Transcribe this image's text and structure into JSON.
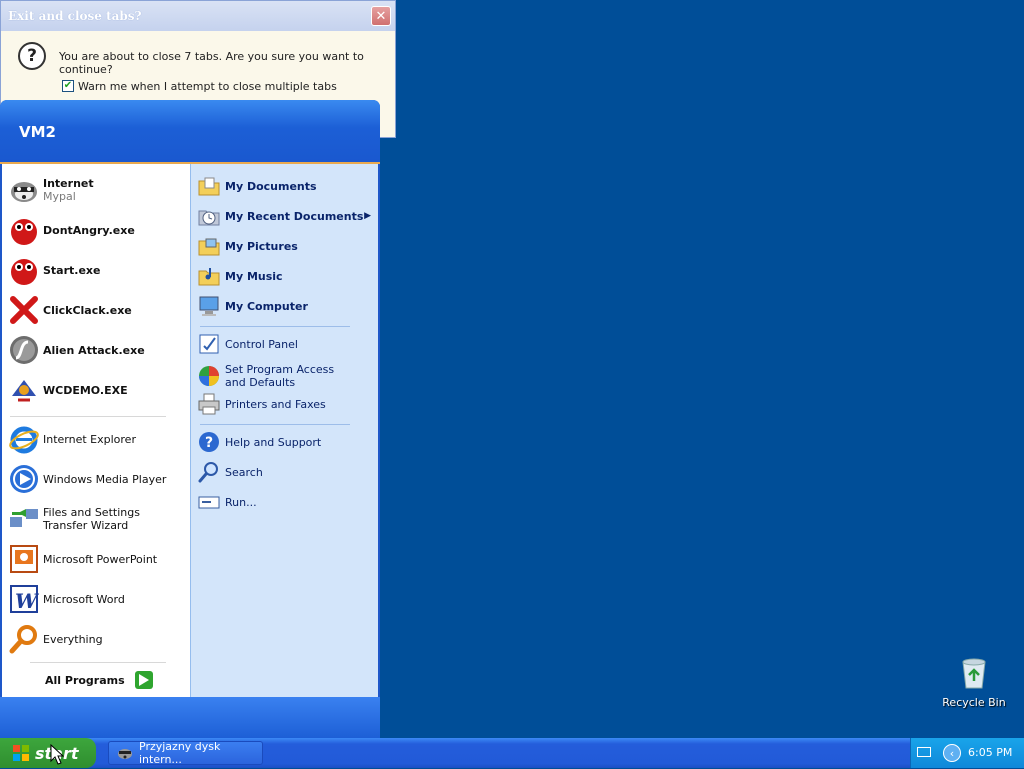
{
  "dialog": {
    "title": "Exit and close tabs?",
    "close_glyph": "✕",
    "question_glyph": "?",
    "message": "You are about to close 7 tabs. Are you sure you want to continue?",
    "checkbox_label": "Warn me when I attempt to close multiple tabs",
    "checkbox_checked": true,
    "check_glyph": "✔"
  },
  "start_menu": {
    "user": "VM2",
    "pinned": [
      {
        "title": "Internet",
        "subtitle": "Mypal",
        "icon": "raccoon-icon"
      },
      {
        "title": "DontAngry.exe",
        "icon": "red-ball-icon"
      },
      {
        "title": "Start.exe",
        "icon": "red-ball-icon"
      },
      {
        "title": "ClickClack.exe",
        "icon": "red-x-icon"
      },
      {
        "title": "Alien Attack.exe",
        "icon": "flash-icon"
      },
      {
        "title": "WCDEMO.EXE",
        "icon": "bird-icon"
      }
    ],
    "recent": [
      {
        "title": "Internet Explorer",
        "icon": "internet-explorer-icon"
      },
      {
        "title": "Windows Media Player",
        "icon": "media-player-icon"
      },
      {
        "title": "Files and Settings Transfer Wizard",
        "icon": "transfer-wizard-icon"
      },
      {
        "title": "Microsoft PowerPoint",
        "icon": "powerpoint-icon"
      },
      {
        "title": "Microsoft Word",
        "icon": "word-icon"
      },
      {
        "title": "Everything",
        "icon": "magnifier-icon"
      }
    ],
    "all_programs": "All Programs",
    "places": [
      {
        "title": "My Documents",
        "icon": "folder-documents-icon"
      },
      {
        "title": "My Recent Documents",
        "icon": "recent-documents-icon",
        "arrow": "▶"
      },
      {
        "title": "My Pictures",
        "icon": "folder-pictures-icon"
      },
      {
        "title": "My Music",
        "icon": "folder-music-icon"
      },
      {
        "title": "My Computer",
        "icon": "computer-icon"
      }
    ],
    "system": [
      {
        "title": "Control Panel",
        "icon": "control-panel-icon"
      },
      {
        "title": "Set Program Access and Defaults",
        "icon": "program-defaults-icon"
      },
      {
        "title": "Printers and Faxes",
        "icon": "printer-icon"
      }
    ],
    "help": [
      {
        "title": "Help and Support",
        "icon": "help-icon"
      },
      {
        "title": "Search",
        "icon": "search-icon"
      },
      {
        "title": "Run...",
        "icon": "run-icon"
      }
    ]
  },
  "taskbar": {
    "start_label": "start",
    "task": "Przyjazny dysk intern...",
    "clock": "6:05 PM",
    "tray_arrow": "‹"
  },
  "desktop": {
    "recycle_bin": "Recycle Bin"
  },
  "colors": {
    "desktop": "#004e98",
    "start_green": "#2f8e2f",
    "menu_blue": "#1e57c9",
    "places_panel": "#d3e5fa"
  }
}
